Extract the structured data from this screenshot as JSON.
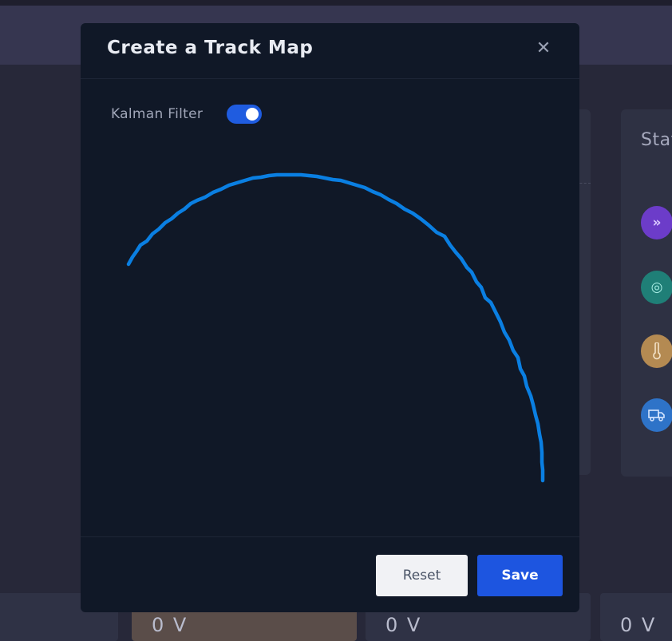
{
  "modal": {
    "title": "Create a Track Map",
    "close_icon": "close-icon",
    "toggle_label": "Kalman Filter",
    "toggle_on": true,
    "track_color": "#0a7fe2",
    "reset_label": "Reset",
    "save_label": "Save"
  },
  "background": {
    "card_title": "Stat",
    "stat_icons": [
      {
        "name": "double-chevron-icon",
        "glyph": "»",
        "color": "#6c3cc9"
      },
      {
        "name": "target-icon",
        "glyph": "◎",
        "color": "#1f7f77"
      },
      {
        "name": "thermometer-icon",
        "glyph": "🌡",
        "color": "#b48a52"
      },
      {
        "name": "truck-icon",
        "glyph": "⛟",
        "color": "#2e73c8"
      }
    ],
    "voltages": [
      "0 V",
      "0 V",
      "0 V"
    ]
  }
}
